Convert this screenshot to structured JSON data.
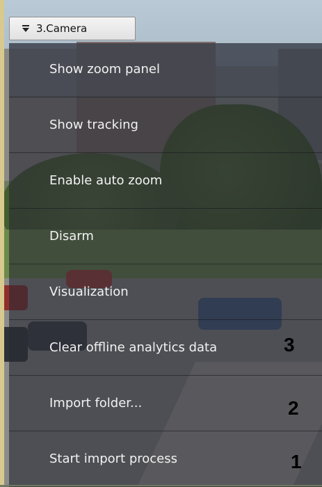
{
  "camera_tab": {
    "title": "3.Camera"
  },
  "menu": {
    "items": [
      {
        "label": "Show zoom panel"
      },
      {
        "label": "Show tracking"
      },
      {
        "label": "Enable auto zoom"
      },
      {
        "label": "Disarm"
      },
      {
        "label": "Visualization"
      },
      {
        "label": "Clear offline analytics data"
      },
      {
        "label": "Import folder..."
      },
      {
        "label": "Start import process"
      }
    ]
  },
  "markers": [
    "3",
    "2",
    "1"
  ],
  "colors": {
    "menu_background": "#282a34",
    "menu_text": "#f2f2f2",
    "tab_background": "#ececec"
  }
}
